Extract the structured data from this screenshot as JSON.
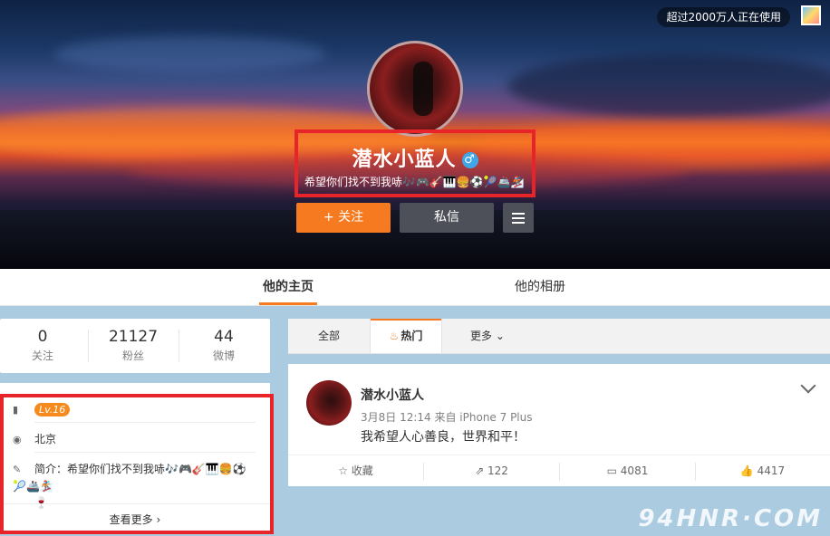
{
  "cover": {
    "users_badge": "超过2000万人正在使用",
    "profile": {
      "name": "潜水小蓝人",
      "gender_icon": "♂",
      "bio": "希望你们找不到我哧🎶🎮🎸🎹🍔⚽🎾🚢🏂🍷"
    },
    "buttons": {
      "follow_label": "+ 关注",
      "message_label": "私信"
    }
  },
  "tabs": [
    {
      "label": "他的主页",
      "active": true
    },
    {
      "label": "他的相册",
      "active": false
    }
  ],
  "stats": [
    {
      "value": "0",
      "label": "关注"
    },
    {
      "value": "21127",
      "label": "粉丝"
    },
    {
      "value": "44",
      "label": "微博"
    }
  ],
  "info": {
    "level": "Lv.16",
    "location": "北京",
    "intro_line1": "简介：希望你们找不到我哧🎶🎮🎸🎹🍔⚽🎾🚢🏂",
    "intro_line2": "🍷",
    "see_more": "查看更多"
  },
  "feed_tabs": {
    "all": "全部",
    "hot": "热门",
    "more": "更多"
  },
  "post": {
    "user": "潜水小蓝人",
    "meta": "3月8日 12:14 来自 iPhone 7 Plus",
    "text": "我希望人心善良，世界和平！",
    "actions": {
      "favorite": "收藏",
      "repost": "122",
      "comment": "4081",
      "like": "4417"
    }
  },
  "watermark": "94HNR·COM",
  "colors": {
    "accent": "#f67a1f",
    "highlight": "#e8242b",
    "page_bg": "#aacbe0"
  }
}
